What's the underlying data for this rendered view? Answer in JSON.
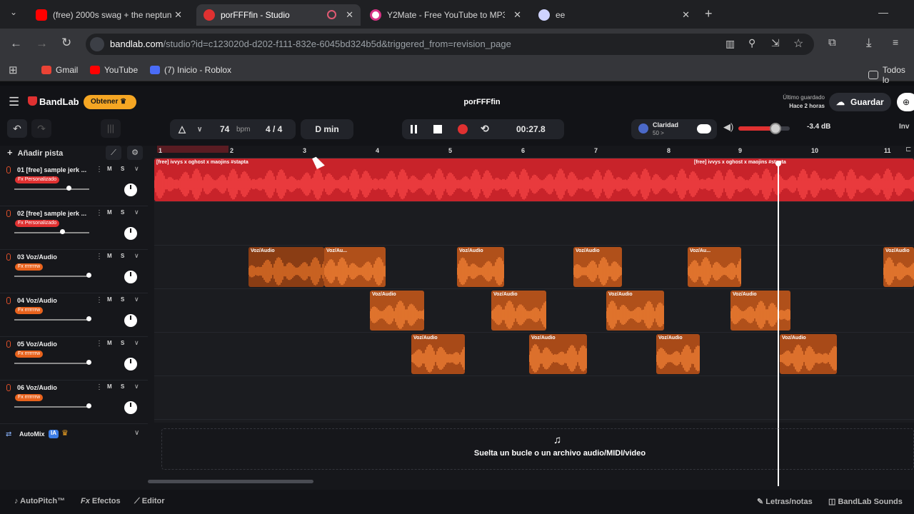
{
  "browser": {
    "tabs": [
      {
        "title": "(free) 2000s swag + the neptun",
        "active": false,
        "color": "#ff0000"
      },
      {
        "title": "porFFFfin - Studio",
        "active": true,
        "color": "#e03131"
      },
      {
        "title": "Y2Mate - Free YouTube to MP3",
        "active": false,
        "color": "#d63384"
      },
      {
        "title": "ee",
        "active": false,
        "color": "#8a8fd6"
      }
    ],
    "url_domain": "bandlab.com",
    "url_rest": "/studio?id=c123020d-d202-f111-832e-6045bd324b5d&triggered_from=revision_page",
    "bookmarks": [
      {
        "label": "Gmail",
        "color": "#ea4335"
      },
      {
        "label": "YouTube",
        "color": "#ff0000"
      },
      {
        "label": "(7) Inicio - Roblox",
        "color": "#4a6cf7"
      }
    ],
    "bookmarks_right": "Todos lo"
  },
  "app": {
    "brand": "BandLab",
    "obtener_label": "Obtener",
    "project_title": "porFFFfin",
    "last_saved_label": "Último guardado",
    "last_saved_value": "Hace 2 horas",
    "save_label": "Guardar",
    "invite_label": "Inv",
    "transport": {
      "bpm": "74",
      "bpm_unit": "bpm",
      "time_sig": "4 / 4",
      "key": "D min",
      "time": "00:27.8",
      "claridad_label": "Claridad",
      "claridad_value": "50 >",
      "master_db": "-3.4 dB",
      "master_volume": 0.72
    },
    "add_track_label": "Añadir pista",
    "ruler": [
      "1",
      "2",
      "3",
      "4",
      "5",
      "6",
      "7",
      "8",
      "9",
      "10",
      "11"
    ],
    "tracks": [
      {
        "num": "01",
        "name": "[free] sample jerk ...",
        "fx": "Fx Personalizado",
        "fx_color": "#e03131",
        "volume": 0.72
      },
      {
        "num": "02",
        "name": "[free] sample jerk ...",
        "fx": "Fx Personalizado",
        "fx_color": "#e03131",
        "volume": 0.64
      },
      {
        "num": "03",
        "name": "Voz/Audio",
        "fx": "Fx rrrrrrrw",
        "fx_color": "#e8621c",
        "volume": 0.99
      },
      {
        "num": "04",
        "name": "Voz/Audio",
        "fx": "Fx rrrrrrrw",
        "fx_color": "#e8621c",
        "volume": 0.99
      },
      {
        "num": "05",
        "name": "Voz/Audio",
        "fx": "Fx rrrrrrrw",
        "fx_color": "#e8621c",
        "volume": 0.99
      },
      {
        "num": "06",
        "name": "Voz/Audio",
        "fx": "Fx rrrrrrrw",
        "fx_color": "#e8621c",
        "volume": 0.99
      }
    ],
    "m_label": "M",
    "s_label": "S",
    "automix_label": "AutoMix",
    "automix_badge": "IA",
    "drop_text": "Suelta un bucle o un archivo audio/MIDI/video",
    "clip_labels": {
      "sample": "[free] ivvys x oghost x maojins #stapta",
      "voz": "Voz/Audio",
      "voz_short": "Voz/Au..."
    },
    "bottom": {
      "autopitch": "AutoPitch™",
      "efectos": "Efectos",
      "fx_prefix": "Fx",
      "editor": "Editor",
      "letras": "Letras/notas",
      "sounds": "BandLab Sounds"
    }
  }
}
